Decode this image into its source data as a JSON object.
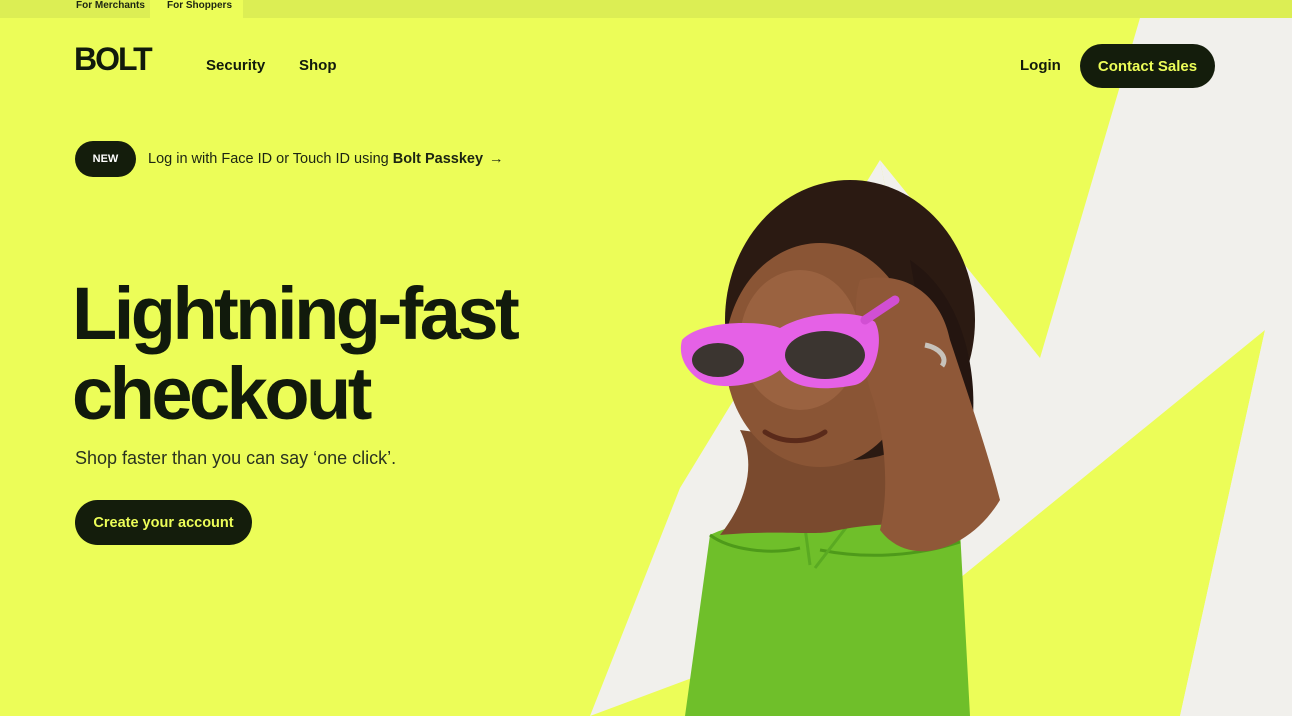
{
  "audience_tabs": [
    {
      "label": "For Merchants",
      "active": false
    },
    {
      "label": "For Shoppers",
      "active": true
    }
  ],
  "header": {
    "logo_text": "BOLT",
    "nav": [
      {
        "label": "Security"
      },
      {
        "label": "Shop"
      }
    ],
    "login_label": "Login",
    "contact_label": "Contact Sales"
  },
  "announcement": {
    "badge": "NEW",
    "text": "Log in with Face ID or Touch ID using ",
    "link_text": "Bolt Passkey",
    "arrow": "→"
  },
  "hero": {
    "title_line1": "Lightning-fast",
    "title_line2": "checkout",
    "subtitle": "Shop faster than you can say ‘one click’.",
    "cta_label": "Create your account",
    "image_subject": "woman-with-pink-sunglasses"
  },
  "colors": {
    "brand_yellow": "#ecfd58",
    "dark": "#141d0c",
    "lightning_white": "#f1f0ec",
    "sunglasses_pink": "#e561e6",
    "top_green": "#6fbf2a"
  }
}
